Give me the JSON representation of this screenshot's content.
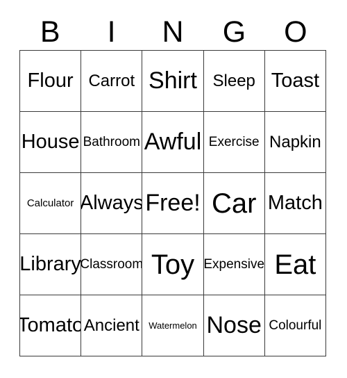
{
  "card": {
    "title": "BINGO",
    "header_letters": [
      "B",
      "I",
      "N",
      "G",
      "O"
    ],
    "columns": 5,
    "rows": 5,
    "free_space": "Free!",
    "free_space_position": {
      "row": 3,
      "column": 3
    },
    "border_color": "#3a3a3a",
    "background_color": "#ffffff",
    "text_color": "#000000",
    "cells": [
      [
        {
          "text": "Flour",
          "size": "lg"
        },
        {
          "text": "Carrot",
          "size": "md"
        },
        {
          "text": "Shirt",
          "size": "xl"
        },
        {
          "text": "Sleep",
          "size": "md"
        },
        {
          "text": "Toast",
          "size": "lg"
        }
      ],
      [
        {
          "text": "House",
          "size": "lg"
        },
        {
          "text": "Bathroom",
          "size": "sm"
        },
        {
          "text": "Awful",
          "size": "xl"
        },
        {
          "text": "Exercise",
          "size": "sm"
        },
        {
          "text": "Napkin",
          "size": "md"
        }
      ],
      [
        {
          "text": "Calculator",
          "size": "xs"
        },
        {
          "text": "Always",
          "size": "lg"
        },
        {
          "text": "Free!",
          "size": "xl"
        },
        {
          "text": "Car",
          "size": "xxl"
        },
        {
          "text": "Match",
          "size": "lg"
        }
      ],
      [
        {
          "text": "Library",
          "size": "lg"
        },
        {
          "text": "Classroom",
          "size": "sm"
        },
        {
          "text": "Toy",
          "size": "xxl"
        },
        {
          "text": "Expensive",
          "size": "sm"
        },
        {
          "text": "Eat",
          "size": "xxl"
        }
      ],
      [
        {
          "text": "Tomato",
          "size": "lg"
        },
        {
          "text": "Ancient",
          "size": "md"
        },
        {
          "text": "Watermelon",
          "size": "xxs"
        },
        {
          "text": "Nose",
          "size": "xl"
        },
        {
          "text": "Colourful",
          "size": "sm"
        }
      ]
    ]
  }
}
